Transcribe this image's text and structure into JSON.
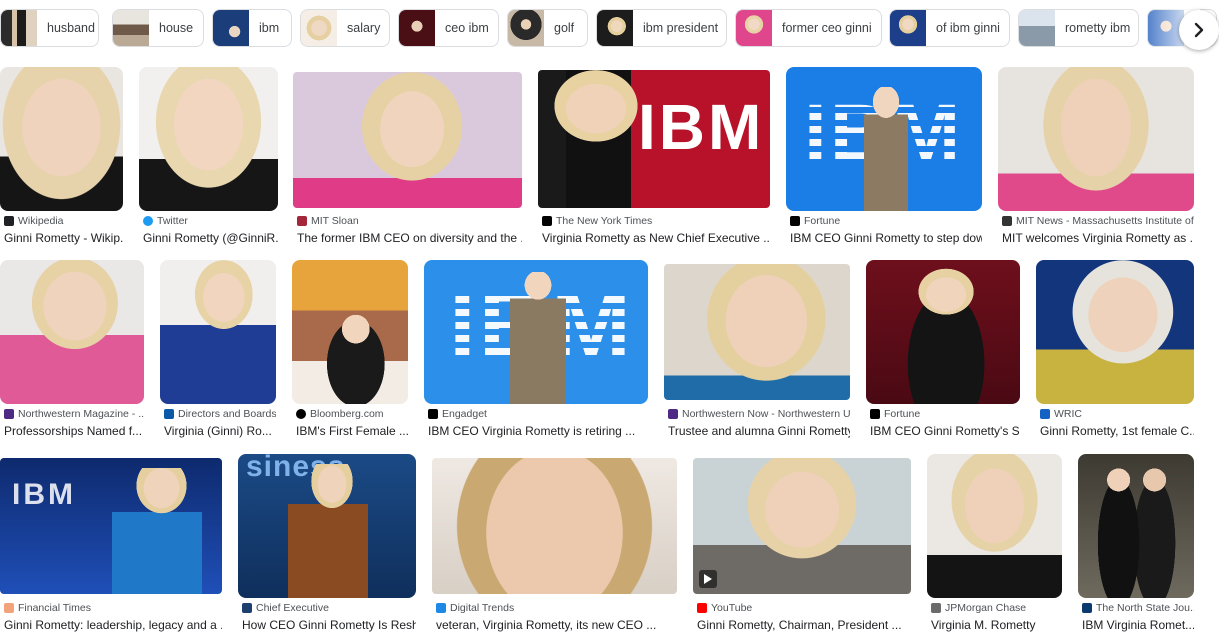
{
  "chips": [
    {
      "label": "husband"
    },
    {
      "label": "house"
    },
    {
      "label": "ibm"
    },
    {
      "label": "salary"
    },
    {
      "label": "ceo ibm"
    },
    {
      "label": "golf"
    },
    {
      "label": "ibm president"
    },
    {
      "label": "former ceo ginni"
    },
    {
      "label": "of ibm ginni"
    },
    {
      "label": "rometty ibm"
    },
    {
      "label": ""
    }
  ],
  "results": [
    {
      "source": "Wikipedia",
      "title": "Ginni Rometty - Wikip..."
    },
    {
      "source": "Twitter",
      "title": "Ginni Rometty (@GinniR..."
    },
    {
      "source": "MIT Sloan",
      "title": "The former IBM CEO on diversity and the ..."
    },
    {
      "source": "The New York Times",
      "title": "Virginia Rometty as New Chief Executive ...",
      "overlay": "IBM"
    },
    {
      "source": "Fortune",
      "title": "IBM CEO Ginni Rometty to step dow...",
      "overlay": "IBM"
    },
    {
      "source": "MIT News - Massachusetts Institute of...",
      "title": "MIT welcomes Virginia Rometty as ..."
    },
    {
      "source": "Northwestern Magazine - ...",
      "title": "Professorships Named f..."
    },
    {
      "source": "Directors and Boards",
      "title": "Virginia (Ginni) Ro..."
    },
    {
      "source": "Bloomberg.com",
      "title": "IBM's First Female ..."
    },
    {
      "source": "Engadget",
      "title": "IBM CEO Virginia Rometty is retiring ...",
      "overlay": "IBM"
    },
    {
      "source": "Northwestern Now - Northwestern U...",
      "title": "Trustee and alumna Ginni Rometty..."
    },
    {
      "source": "Fortune",
      "title": "IBM CEO Ginni Rometty's S..."
    },
    {
      "source": "WRIC",
      "title": "Ginni Rometty, 1st female C..."
    },
    {
      "source": "Financial Times",
      "title": "Ginni Rometty: leadership, legacy and a ...",
      "overlay": "IBM"
    },
    {
      "source": "Chief Executive",
      "title": "How CEO Ginni Rometty Is Resh...",
      "overlay": "siness"
    },
    {
      "source": "Digital Trends",
      "title": "veteran, Virginia Rometty, its new CEO ..."
    },
    {
      "source": "YouTube",
      "title": "Ginni Rometty, Chairman, President ..."
    },
    {
      "source": "JPMorgan Chase",
      "title": "Virginia M. Rometty"
    },
    {
      "source": "The North State Jou...",
      "title": "IBM Virginia Romet..."
    }
  ],
  "colors": {
    "ibm_blue": "#1a7ee6",
    "text": "#202124",
    "source_text": "#4d5156",
    "chip_border": "#dadce0"
  },
  "icons": {
    "chips_next": "chevron-right-icon",
    "play": "play-icon"
  }
}
